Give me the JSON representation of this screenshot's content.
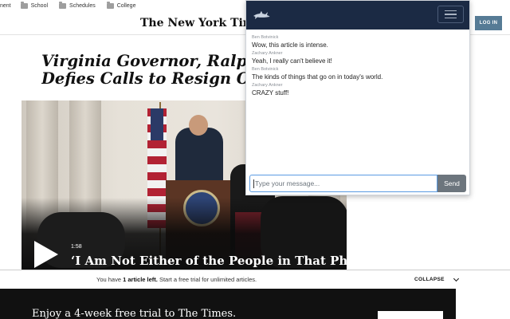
{
  "bookmarks": [
    {
      "label": "nent"
    },
    {
      "label": "School"
    },
    {
      "label": "Schedules"
    },
    {
      "label": "College"
    }
  ],
  "header": {
    "logo": "The New York Times",
    "login_label": "LOG IN"
  },
  "article": {
    "headline_line1": "Virginia Governor, Ralph Northam,",
    "headline_line2": "Defies Calls to Resign Over Racist",
    "video_duration": "1:58",
    "video_caption": "‘I Am Not Either of the People in That Photo’"
  },
  "banner": {
    "text_prefix": "You have ",
    "text_bold": "1 article left.",
    "text_suffix": " Start a free trial for unlimited articles.",
    "collapse_label": "COLLAPSE"
  },
  "trial": {
    "text": "Enjoy a 4-week free trial to The Times."
  },
  "chat": {
    "messages": [
      {
        "author": "Ben Botvinick",
        "text": "Wow, this article is intense."
      },
      {
        "author": "Zachary Ankner",
        "text": "Yeah, I really can't believe it!"
      },
      {
        "author": "Ben Botvinick",
        "text": "The kinds of things that go on in today's world."
      },
      {
        "author": "Zachary Ankner",
        "text": "CRAZY stuff!"
      }
    ],
    "input_placeholder": "Type your message...",
    "send_label": "Send",
    "nav_color": "#1b2a44"
  },
  "colors": {
    "login_button": "#567b95",
    "send_button": "#6c757d",
    "input_focus": "#5a9be2"
  }
}
